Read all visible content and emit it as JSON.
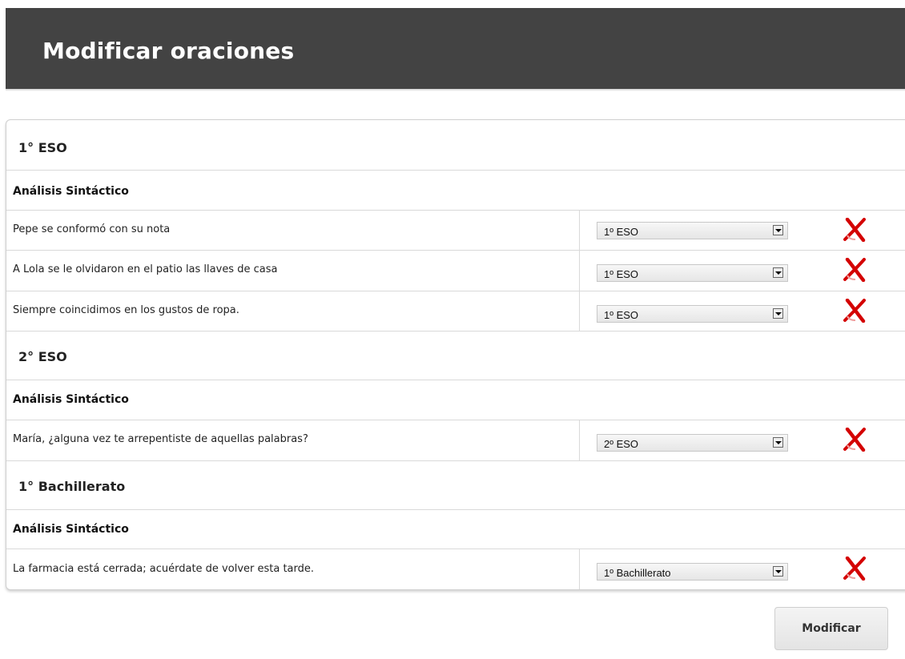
{
  "page": {
    "title": "Modificar oraciones"
  },
  "groups": [
    {
      "level": "1° ESO",
      "type": "Análisis Sintáctico",
      "sentences": [
        {
          "text": "Pepe se conformó con su nota",
          "selected": "1º ESO"
        },
        {
          "text": "A Lola se le olvidaron en el patio las llaves de casa",
          "selected": "1º ESO"
        },
        {
          "text": "Siempre coincidimos en los gustos de ropa.",
          "selected": "1º ESO"
        }
      ]
    },
    {
      "level": "2° ESO",
      "type": "Análisis Sintáctico",
      "sentences": [
        {
          "text": "María, ¿alguna vez te arrepentiste de aquellas palabras?",
          "selected": "2º ESO"
        }
      ]
    },
    {
      "level": "1° Bachillerato",
      "type": "Análisis Sintáctico",
      "sentences": [
        {
          "text": "La farmacia está cerrada; acuérdate de volver esta tarde.",
          "selected": "1º Bachillerato"
        }
      ]
    }
  ],
  "actions": {
    "submit_label": "Modificar"
  },
  "icons": {
    "delete": "delete-x-icon"
  },
  "colors": {
    "header_bg": "#434343",
    "delete_red": "#d40000"
  }
}
